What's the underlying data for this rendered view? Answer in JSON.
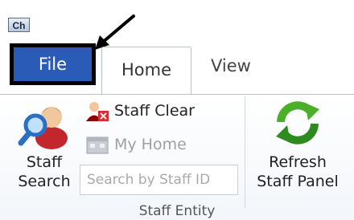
{
  "app": {
    "icon_text": "Ch"
  },
  "tabs": {
    "file": "File",
    "home": "Home",
    "view": "View"
  },
  "ribbon": {
    "staff_search": {
      "line1": "Staff",
      "line2": "Search"
    },
    "staff_clear": "Staff Clear",
    "my_home": "My Home",
    "search_placeholder": "Search by Staff ID",
    "refresh": {
      "line1": "Refresh",
      "line2": "Staff Panel"
    },
    "group_label": "Staff Entity"
  },
  "colors": {
    "file_tab": "#2a5bb7",
    "highlight_border": "#000000",
    "disabled_text": "#a0a0a0"
  }
}
